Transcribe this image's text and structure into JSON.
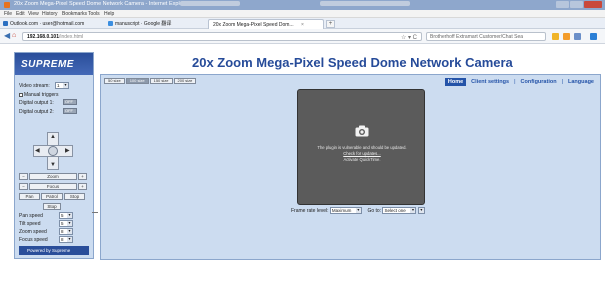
{
  "browser": {
    "window_title": "20x Zoom Mega-Pixel Speed Dome Network Camera - Internet Explorer",
    "menus": [
      "File",
      "Edit",
      "View",
      "History",
      "Bookmarks",
      "Tools",
      "Help"
    ],
    "bookmarks": [
      {
        "label": "Outlook.com · user@hotmail.com",
        "icon": "mail-icon",
        "color": "#2b6fc1"
      },
      {
        "label": "manuscript · Google 翻译",
        "icon": "translate-icon",
        "color": "#3b8ee0"
      }
    ],
    "tab": {
      "label": "20x Zoom Mega-Pixel Speed Dom...",
      "close": "×"
    },
    "new_tab": "+",
    "url": {
      "host": "192.168.0.101",
      "path": "/index.html"
    },
    "url_right": "☆ ▾ C",
    "search_placeholder": "Brotherhoff Extramart Customer/Chat Sea",
    "window_controls": {
      "close_color": "#c9483a"
    }
  },
  "sidebar": {
    "logo": "SUPREME",
    "video_stream_label": "Video stream:",
    "video_stream_value": "1",
    "manual_triggers_label": "Manual triggers",
    "digital_output_1_label": "Digital output 1:",
    "digital_output_1_value": "OFF",
    "digital_output_2_label": "Digital output 2:",
    "digital_output_2_value": "OFF",
    "zoom_row": {
      "minus": "−",
      "label": "Zoom",
      "plus": "+"
    },
    "focus_row": {
      "minus": "−",
      "label": "Focus",
      "plus": "+"
    },
    "mode_row": [
      "Pan",
      "Patrol",
      "Stop"
    ],
    "home_label": "Stop",
    "pan_speed_label": "Pan speed",
    "pan_speed_value": "5",
    "tilt_speed_label": "Tilt speed",
    "tilt_speed_value": "5",
    "zoom_speed_label": "Zoom speed",
    "zoom_speed_value": "8",
    "focus_speed_label": "Focus speed",
    "focus_speed_value": "8",
    "powered_by": "Powered by Supreme"
  },
  "main": {
    "title": "20x Zoom Mega-Pixel Speed Dome Network Camera",
    "size_buttons": [
      "50 size",
      "100 size",
      "150 size",
      "200 size"
    ],
    "nav": [
      "Home",
      "Client settings",
      "Configuration",
      "Language"
    ],
    "video_message": "The plugin is vulnerable and should be updated.",
    "video_link": "Check for updates...",
    "video_action": "Activate QuickTime.",
    "frame_rate_label": "Frame rate level:",
    "frame_rate_value": "Maximum",
    "goto_label": "Go to:",
    "goto_value": "Select one"
  }
}
